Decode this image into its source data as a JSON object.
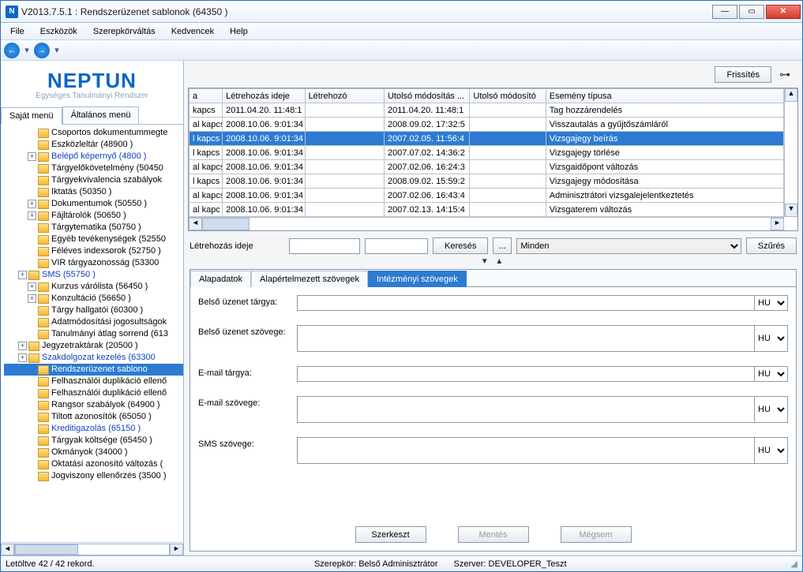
{
  "window": {
    "title": "V2013.7.5.1 : Rendszerüzenet sablonok (64350  )"
  },
  "menu": {
    "items": [
      "File",
      "Eszközök",
      "Szerepkörváltás",
      "Kedvencek",
      "Help"
    ]
  },
  "logo": {
    "brand": "NEPTUN",
    "sub": "Egységes Tanulmányi Rendszer"
  },
  "left_tabs": {
    "items": [
      "Saját menü",
      "Általános menü"
    ],
    "active": 0
  },
  "tree": {
    "items": [
      {
        "label": "Csoportos dokumentummegte",
        "indent": 1,
        "expander": ""
      },
      {
        "label": "Eszközleltár (48900  )",
        "indent": 1,
        "expander": ""
      },
      {
        "label": "Belépő képernyő (4800  )",
        "indent": 1,
        "expander": "+",
        "link": true
      },
      {
        "label": "Tárgyelőkövetelmény (50450",
        "indent": 1,
        "expander": ""
      },
      {
        "label": "Tárgyekvivalencia szabályok",
        "indent": 1,
        "expander": ""
      },
      {
        "label": "Iktatás (50350  )",
        "indent": 1,
        "expander": ""
      },
      {
        "label": "Dokumentumok (50550  )",
        "indent": 1,
        "expander": "+"
      },
      {
        "label": "Fájltárolók (50650  )",
        "indent": 1,
        "expander": "+"
      },
      {
        "label": "Tárgytematika (50750  )",
        "indent": 1,
        "expander": ""
      },
      {
        "label": "Egyéb tevékenységek (52550",
        "indent": 1,
        "expander": ""
      },
      {
        "label": "Féléves indexsorok (52750  )",
        "indent": 1,
        "expander": ""
      },
      {
        "label": "VIR tárgyazonosság (53300",
        "indent": 1,
        "expander": ""
      },
      {
        "label": "SMS (55750  )",
        "indent": 0,
        "expander": "+",
        "link": true
      },
      {
        "label": "Kurzus várólista (56450  )",
        "indent": 1,
        "expander": "+"
      },
      {
        "label": "Konzultáció (56650  )",
        "indent": 1,
        "expander": "+"
      },
      {
        "label": "Tárgy hallgatói (60300  )",
        "indent": 1,
        "expander": ""
      },
      {
        "label": "Adatmódosítási jogosultságok",
        "indent": 1,
        "expander": ""
      },
      {
        "label": "Tanulmányi átlag sorrend (613",
        "indent": 1,
        "expander": ""
      },
      {
        "label": "Jegyzetraktárak (20500  )",
        "indent": 0,
        "expander": "+"
      },
      {
        "label": "Szakdolgozat kezelés (63300",
        "indent": 0,
        "expander": "+",
        "link": true
      },
      {
        "label": "Rendszerüzenet sablono",
        "indent": 1,
        "expander": "",
        "selected": true
      },
      {
        "label": "Felhasználói duplikáció ellenő",
        "indent": 1,
        "expander": ""
      },
      {
        "label": "Felhasználói duplikáció ellenő",
        "indent": 1,
        "expander": ""
      },
      {
        "label": "Rangsor szabályok (64900  )",
        "indent": 1,
        "expander": ""
      },
      {
        "label": "Tiltott azonosítók (65050  )",
        "indent": 1,
        "expander": ""
      },
      {
        "label": "Kreditigazolás (65150  )",
        "indent": 1,
        "expander": "",
        "link": true
      },
      {
        "label": "Tárgyak költsége (65450  )",
        "indent": 1,
        "expander": ""
      },
      {
        "label": "Okmányok (34000  )",
        "indent": 1,
        "expander": ""
      },
      {
        "label": "Oktatási azonosító változás (",
        "indent": 1,
        "expander": ""
      },
      {
        "label": "Jogviszony ellenőrzés (3500  )",
        "indent": 1,
        "expander": ""
      }
    ]
  },
  "top_actions": {
    "refresh": "Frissítés"
  },
  "grid": {
    "headers": [
      "a",
      "Létrehozás ideje",
      "Létrehozó",
      "Utolsó módosítás ...",
      "Utolsó módosító",
      "Esemény típusa"
    ],
    "rows": [
      {
        "c0": "kapcs",
        "c1": "2011.04.20. 11:48:1",
        "c2": "",
        "c3": "2011.04.20. 11:48:1",
        "c4": "",
        "c5": "Tag hozzárendelés"
      },
      {
        "c0": "al kapcs",
        "c1": "2008.10.06. 9:01:34",
        "c2": "",
        "c3": "2008.09.02. 17:32:5",
        "c4": "",
        "c5": "Visszautalás a gyűjtőszámláról"
      },
      {
        "c0": "l kapcs",
        "c1": "2008.10.06. 9:01:34",
        "c2": "",
        "c3": "2007.02.05. 11:56:4",
        "c4": "",
        "c5": "Vizsgajegy beírás",
        "sel": true
      },
      {
        "c0": "l kapcs",
        "c1": "2008.10.06. 9:01:34",
        "c2": "",
        "c3": "2007.07.02. 14:36:2",
        "c4": "",
        "c5": "Vizsgajegy törlése"
      },
      {
        "c0": "al kapcs",
        "c1": "2008.10.06. 9:01:34",
        "c2": "",
        "c3": "2007.02.06. 16:24:3",
        "c4": "",
        "c5": "Vizsgaidőpont változás"
      },
      {
        "c0": "l kapcs",
        "c1": "2008.10.06. 9:01:34",
        "c2": "",
        "c3": "2008.09.02. 15:59:2",
        "c4": "",
        "c5": "Vizsgajegy módosítása"
      },
      {
        "c0": "al kapcs",
        "c1": "2008.10.06. 9:01:34",
        "c2": "",
        "c3": "2007.02.06. 16:43:4",
        "c4": "",
        "c5": "Adminisztrátori vizsgalejelentkeztetés"
      },
      {
        "c0": "al kapc",
        "c1": "2008.10.06. 9:01:34",
        "c2": "",
        "c3": "2007.02.13. 14:15:4",
        "c4": "",
        "c5": "Vizsgaterem változás"
      }
    ]
  },
  "search": {
    "label": "Létrehozás ideje",
    "button": "Keresés",
    "more": "...",
    "filter_selected": "Minden",
    "filter_button": "Szűrés"
  },
  "detail_tabs": {
    "items": [
      "Alapadatok",
      "Alapértelmezett szövegek",
      "Intézményi szövegek"
    ],
    "active": 2
  },
  "form": {
    "rows": [
      {
        "label": "Belső üzenet tárgya:",
        "lang": "HU",
        "kind": "input"
      },
      {
        "label": "Belső üzenet szövege:",
        "lang": "HU",
        "kind": "textarea"
      },
      {
        "label": "E-mail tárgya:",
        "lang": "HU",
        "kind": "input"
      },
      {
        "label": "E-mail szövege:",
        "lang": "HU",
        "kind": "textarea"
      },
      {
        "label": "SMS szövege:",
        "lang": "HU",
        "kind": "textarea"
      }
    ]
  },
  "detail_actions": {
    "edit": "Szerkeszt",
    "save": "Mentés",
    "cancel": "Mégsem"
  },
  "status": {
    "left": "Letöltve 42 / 42 rekord.",
    "role": "Szerepkör: Belső Adminisztrátor",
    "server": "Szerver: DEVELOPER_Teszt"
  }
}
